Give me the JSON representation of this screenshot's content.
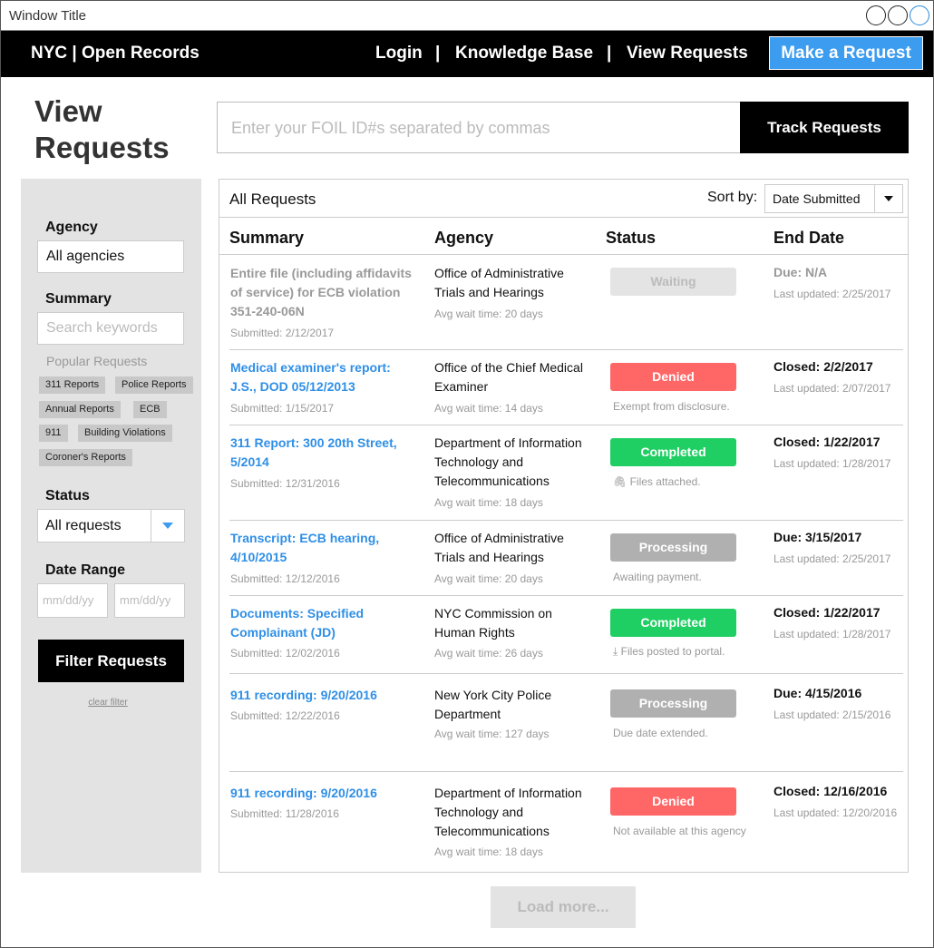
{
  "window": {
    "title": "Window Title"
  },
  "nav": {
    "brand": "NYC | Open Records",
    "login": "Login",
    "separator": "|",
    "knowledge_base": "Knowledge Base",
    "view_requests": "View Requests",
    "make_request": "Make a Request"
  },
  "page": {
    "title": "View Requests"
  },
  "search": {
    "placeholder": "Enter your FOIL ID#s separated by commas",
    "button": "Track Requests"
  },
  "sidebar": {
    "agency_label": "Agency",
    "agency_value": "All agencies",
    "summary_label": "Summary",
    "summary_placeholder": "Search keywords",
    "popular_label": "Popular Requests",
    "tags": [
      "311 Reports",
      "Police Reports",
      "Annual Reports",
      "ECB",
      "911",
      "Building Violations",
      "Coroner's Reports"
    ],
    "status_label": "Status",
    "status_value": "All requests",
    "date_label": "Date Range",
    "date_from_placeholder": "mm/dd/yy",
    "date_to_placeholder": "mm/dd/yy",
    "filter_button": "Filter Requests",
    "clear_filter": "clear filter"
  },
  "list": {
    "title": "All Requests",
    "sort_label": "Sort by:",
    "sort_value": "Date Submitted",
    "columns": {
      "summary": "Summary",
      "agency": "Agency",
      "status": "Status",
      "end_date": "End Date"
    },
    "rows": [
      {
        "title": "Entire file (including affidavits of service) for ECB violation 351-240-06N",
        "submitted": "Submitted: 2/12/2017",
        "agency": "Office of Administrative Trials and Hearings",
        "wait": "Avg wait time: 20 days",
        "status": "Waiting",
        "note": "",
        "end": "Due: N/A",
        "updated": "Last updated: 2/25/2017"
      },
      {
        "title": "Medical examiner's report: J.S., DOD 05/12/2013",
        "submitted": "Submitted: 1/15/2017",
        "agency": "Office of the Chief Medical Examiner",
        "wait": "Avg wait time: 14 days",
        "status": "Denied",
        "note": "Exempt from disclosure.",
        "end": "Closed: 2/2/2017",
        "updated": "Last updated: 2/07/2017"
      },
      {
        "title": "311 Report: 300 20th Street, 5/2014",
        "submitted": "Submitted: 12/31/2016",
        "agency": "Department of Information Technology and Telecommunications",
        "wait": "Avg wait time: 18 days",
        "status": "Completed",
        "note": "Files attached.",
        "end": "Closed: 1/22/2017",
        "updated": "Last updated: 1/28/2017"
      },
      {
        "title": "Transcript: ECB hearing, 4/10/2015",
        "submitted": "Submitted: 12/12/2016",
        "agency": "Office of Administrative Trials and Hearings",
        "wait": "Avg wait time: 20 days",
        "status": "Processing",
        "note": "Awaiting payment.",
        "end": "Due: 3/15/2017",
        "updated": "Last updated: 2/25/2017"
      },
      {
        "title": "Documents: Specified Complainant (JD)",
        "submitted": "Submitted: 12/02/2016",
        "agency": "NYC Commission on Human Rights",
        "wait": "Avg wait time: 26 days",
        "status": "Completed",
        "note": "Files posted to portal.",
        "end": "Closed: 1/22/2017",
        "updated": "Last updated: 1/28/2017"
      },
      {
        "title": "911 recording: 9/20/2016",
        "submitted": "Submitted: 12/22/2016",
        "agency": "New York City Police Department",
        "wait": "Avg wait time: 127 days",
        "status": "Processing",
        "note": "Due date extended.",
        "end": "Due: 4/15/2016",
        "updated": "Last updated: 2/15/2016"
      },
      {
        "title": "911 recording: 9/20/2016",
        "submitted": "Submitted: 11/28/2016",
        "agency": "Department of Information Technology and Telecommunications",
        "wait": "Avg wait time: 18 days",
        "status": "Denied",
        "note": "Not available at this agency",
        "end": "Closed: 12/16/2016",
        "updated": "Last updated: 12/20/2016"
      }
    ]
  },
  "load_more": "Load more...",
  "colors": {
    "accent": "#3b9cf0",
    "link": "#2f8fe6",
    "denied": "#ff6666",
    "completed": "#1fcf63",
    "processing": "#b0b0b0",
    "waiting": "#e4e4e4"
  },
  "icons": {
    "attachment": "paperclip-icon",
    "download": "download-icon",
    "dropdown": "chevron-down-icon"
  }
}
